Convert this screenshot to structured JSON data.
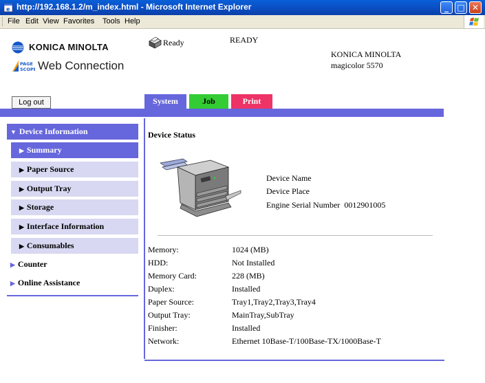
{
  "window": {
    "title": "http://192.168.1.2/m_index.html - Microsoft Internet Explorer"
  },
  "menu": [
    "File",
    "Edit",
    "View",
    "Favorites",
    "Tools",
    "Help"
  ],
  "header": {
    "brand": "KONICA MINOLTA",
    "product": "Web Connection",
    "status_short": "Ready",
    "status_long": "READY",
    "maker": "KONICA MINOLTA",
    "model": "magicolor 5570",
    "logout_label": "Log out"
  },
  "tabs": [
    {
      "label": "System",
      "color": "#6666dd"
    },
    {
      "label": "Job",
      "color": "#33cc33"
    },
    {
      "label": "Print",
      "color": "#ee3366"
    }
  ],
  "sidebar": {
    "head": "Device Information",
    "items": [
      "Summary",
      "Paper Source",
      "Output Tray",
      "Storage",
      "Interface Information",
      "Consumables"
    ],
    "selected": "Summary",
    "top_items": [
      "Counter",
      "Online Assistance"
    ]
  },
  "main": {
    "section_title": "Device Status",
    "device_info": {
      "name_label": "Device Name",
      "place_label": "Device Place",
      "serial_label": "Engine Serial Number",
      "serial_value": "0012901005"
    },
    "rows": [
      {
        "key": "Memory:",
        "value": "1024 (MB)"
      },
      {
        "key": "HDD:",
        "value": "Not Installed"
      },
      {
        "key": "Memory Card:",
        "value": "228 (MB)"
      },
      {
        "key": "Duplex:",
        "value": "Installed"
      },
      {
        "key": "Paper Source:",
        "value": "Tray1,Tray2,Tray3,Tray4"
      },
      {
        "key": "Output Tray:",
        "value": "MainTray,SubTray"
      },
      {
        "key": "Finisher:",
        "value": "Installed"
      },
      {
        "key": "Network:",
        "value": "Ethernet 10Base-T/100Base-TX/1000Base-T"
      }
    ]
  },
  "colors": {
    "accent": "#6666dd",
    "sub_bg": "#d8d8f2"
  }
}
